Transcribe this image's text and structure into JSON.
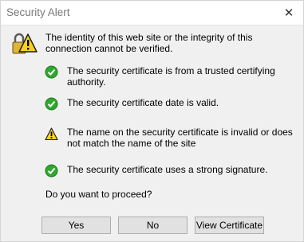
{
  "window": {
    "title": "Security Alert",
    "close_glyph": "✕"
  },
  "alert": {
    "icon": "lock-warning-icon",
    "intro": "The identity of this web site or the integrity of this connection cannot be verified.",
    "checks": [
      {
        "status": "ok",
        "icon": "check-circle-icon",
        "text": "The security certificate is from a trusted certifying authority."
      },
      {
        "status": "ok",
        "icon": "check-circle-icon",
        "text": "The security certificate date is valid."
      },
      {
        "status": "warning",
        "icon": "warning-triangle-icon",
        "text": "The name on the security certificate is invalid or does not match the name of the site"
      },
      {
        "status": "ok",
        "icon": "check-circle-icon",
        "text": "The security certificate uses a strong signature."
      }
    ],
    "question": "Do you want to proceed?"
  },
  "buttons": {
    "yes": "Yes",
    "no": "No",
    "view_certificate": "View Certificate"
  },
  "colors": {
    "ok_green": "#2ea82e",
    "warning_yellow": "#f7d21e",
    "button_face": "#e1e1e1",
    "dialog_bg": "#f0f0f0"
  }
}
